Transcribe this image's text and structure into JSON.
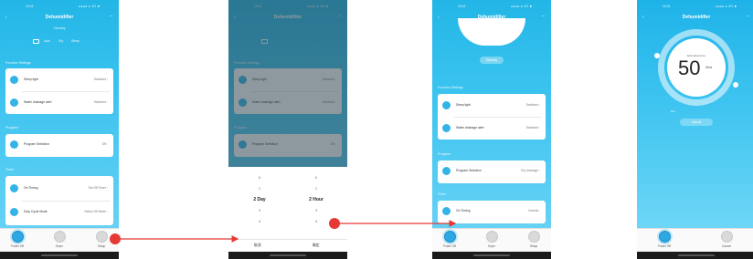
{
  "status_bar": {
    "time": "10:41",
    "right": "●●●● ● 4G ■"
  },
  "device_title": "Dehumidifier",
  "screen1": {
    "subtitle": "Standby",
    "modes": [
      "Auto",
      "Dry",
      "Sleep"
    ],
    "section_function": "Function Settings",
    "rows_function": [
      {
        "label": "Sleep light",
        "value": "Switched"
      },
      {
        "label": "Water drainage alert",
        "value": "Switched"
      }
    ],
    "section_program": "Program",
    "rows_program": [
      {
        "label": "Program Selection",
        "value": "Off"
      }
    ],
    "section_timer": "Timer",
    "rows_timer": [
      {
        "label": "On Timing",
        "value": "Set Off Timer"
      },
      {
        "label": "Duty Cycle Mode",
        "value": "Select Off Mode"
      }
    ]
  },
  "screen2": {
    "section_function": "Function Settings",
    "rows_function": [
      {
        "label": "Sleep light",
        "value": "Switched"
      },
      {
        "label": "Water drainage alert",
        "value": "Switched"
      }
    ],
    "section_program": "Program",
    "rows_program": [
      {
        "label": "Program Selection",
        "value": "Off"
      }
    ],
    "picker_left": [
      "0",
      "1",
      "2 Day",
      "3",
      "4"
    ],
    "picker_right": [
      "0",
      "1",
      "2 Hour",
      "3",
      "4"
    ],
    "cancel": "取消",
    "confirm": "确定"
  },
  "screen3": {
    "pill": "Standby",
    "section_function": "Function Settings",
    "rows_function": [
      {
        "label": "Sleep light",
        "value": "Switched"
      },
      {
        "label": "Water drainage alert",
        "value": "Switched"
      }
    ],
    "section_program": "Program",
    "rows_program": [
      {
        "label": "Program Selection",
        "value": "Dry drainage"
      }
    ],
    "section_timer": "Timer",
    "rows_timer": [
      {
        "label": "On Timing",
        "value": "Normal"
      }
    ]
  },
  "screen4": {
    "dial_label": "Estimated time",
    "dial_value": "50",
    "dial_unit": "Mins",
    "minutes_caption": "Min",
    "cancel_label": "Cancel"
  },
  "tabbar": {
    "tabs": [
      "Power Off",
      "Dryer",
      "Setup"
    ]
  },
  "tabbar4": {
    "tabs": [
      "Power Off",
      "Cancel"
    ]
  },
  "colors": {
    "accent": "#2ea8e2",
    "arrow": "#e53935",
    "bg_top": "#22b6e6"
  }
}
